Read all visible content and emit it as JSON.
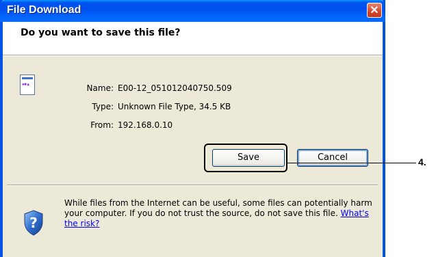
{
  "window": {
    "title": "File Download",
    "close_label": "✕"
  },
  "prompt": {
    "question": "Do you want to save this file?"
  },
  "file": {
    "name_label": "Name:",
    "name": "E00-12_051012040750.509",
    "type_label": "Type:",
    "type": "Unknown File Type, 34.5 KB",
    "from_label": "From:",
    "from": "192.168.0.10",
    "icon": "unknown-file-icon"
  },
  "buttons": {
    "save": "Save",
    "cancel": "Cancel"
  },
  "callout": {
    "number": "4."
  },
  "warning": {
    "text": "While files from the Internet can be useful, some files can potentially harm your computer. If you do not trust the source, do not save this file. ",
    "link": "What's the risk?",
    "icon": "shield-question-icon"
  },
  "colors": {
    "title_bar": "#0054e3",
    "close_button": "#d6452a",
    "dialog_bg": "#ece9d8",
    "link": "#0000ff"
  }
}
